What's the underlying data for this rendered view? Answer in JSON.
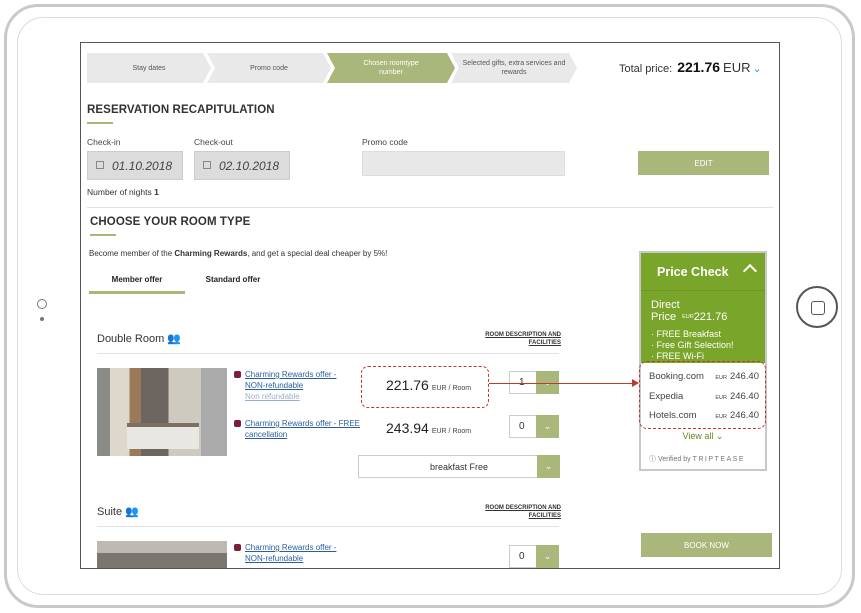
{
  "steps": [
    {
      "label": "Stay dates"
    },
    {
      "label": "Promo code"
    },
    {
      "label": "Chosen roomtype number"
    },
    {
      "label": "Selected gifts, extra services and rewards"
    }
  ],
  "total": {
    "label": "Total price:",
    "amount": "221.76",
    "currency": "EUR"
  },
  "recap": {
    "title": "RESERVATION RECAPITULATION",
    "checkin_label": "Check-in",
    "checkin_value": "01.10.2018",
    "checkout_label": "Check-out",
    "checkout_value": "02.10.2018",
    "promo_label": "Promo code",
    "edit_label": "EDIT",
    "nights_label": "Number of nights",
    "nights_value": "1"
  },
  "roomtype": {
    "title": "CHOOSE YOUR ROOM TYPE",
    "member_prefix": "Become member of the ",
    "member_brand": "Charming Rewards",
    "member_suffix": ", and get a special deal cheaper by 5%!",
    "tabs": [
      {
        "label": "Member offer"
      },
      {
        "label": "Standard offer"
      }
    ]
  },
  "rooms": {
    "double": {
      "title": "Double Room",
      "desc_link": "ROOM DESCRIPTION AND FACILITIES",
      "offer1_line1": "Charming Rewards offer -",
      "offer1_line2": "NON-refundable",
      "offer1_line3": "Non refundable",
      "offer1_price": "221.76",
      "offer1_qty": "1",
      "offer2_line1": "Charming Rewards offer - FREE",
      "offer2_line2": "cancellation",
      "offer2_price": "243.94",
      "offer2_qty": "0",
      "unit": "EUR / Room",
      "board": "breakfast Free"
    },
    "suite": {
      "title": "Suite",
      "desc_link": "ROOM DESCRIPTION AND FACILITIES",
      "offer1_line1": "Charming Rewards offer -",
      "offer1_line2": "NON-refundable",
      "offer1_qty": "0"
    }
  },
  "price_check": {
    "title": "Price Check",
    "direct_label": "Direct Price",
    "direct_currency": "EUR",
    "direct_value": "221.76",
    "features": [
      "· FREE Breakfast",
      "· Free Gift Selection!",
      "· FREE Wi-Fi"
    ],
    "competitors": [
      {
        "name": "Booking.com",
        "currency": "EUR",
        "price": "246.40"
      },
      {
        "name": "Expedia",
        "currency": "EUR",
        "price": "246.40"
      },
      {
        "name": "Hotels.com",
        "currency": "EUR",
        "price": "246.40"
      }
    ],
    "view_all": "View all",
    "verified_prefix": "Verified by",
    "verified_brand": "TRIPTEASE"
  },
  "book_label": "BOOK NOW",
  "colors": {
    "accent": "#a9b77a",
    "widget_green": "#7aa52b",
    "highlight": "#c0392b",
    "link": "#2a5f9e"
  }
}
